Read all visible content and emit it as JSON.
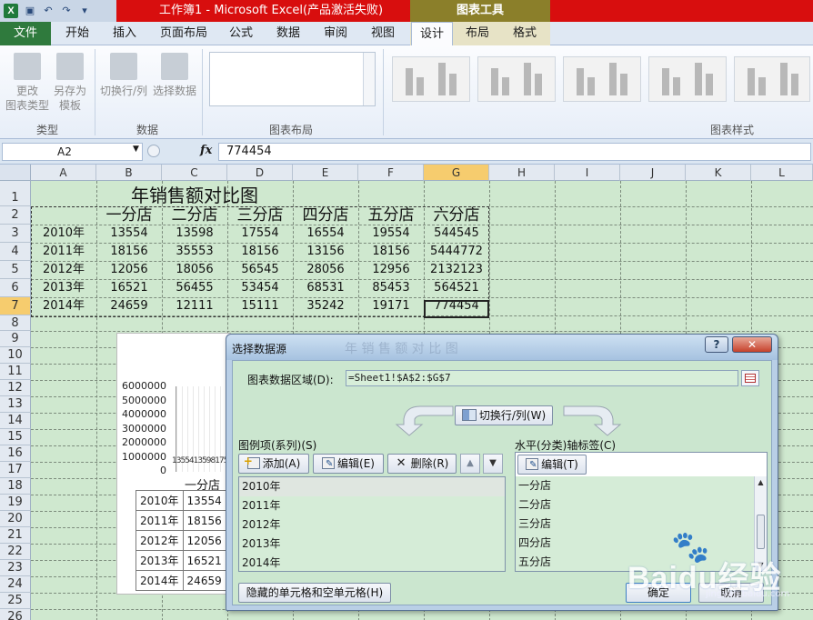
{
  "window": {
    "title": "工作簿1 - Microsoft Excel(产品激活失败)",
    "context_tab_group": "图表工具"
  },
  "ribbon": {
    "tabs": [
      "文件",
      "开始",
      "插入",
      "页面布局",
      "公式",
      "数据",
      "审阅",
      "视图",
      "设计",
      "布局",
      "格式"
    ],
    "active_tab": "设计",
    "groups": {
      "type": {
        "label": "类型",
        "change_type": "更改\n图表类型",
        "save_template": "另存为\n模板"
      },
      "data": {
        "label": "数据",
        "switch_row_col": "切换行/列",
        "select_data": "选择数据"
      },
      "layout": {
        "label": "图表布局"
      },
      "styles": {
        "label": "图表样式"
      }
    }
  },
  "formula_bar": {
    "name_box": "A2",
    "fx": "fx",
    "value": "774454"
  },
  "sheet": {
    "columns": [
      "A",
      "B",
      "C",
      "D",
      "E",
      "F",
      "G",
      "H",
      "I",
      "J",
      "K",
      "L"
    ],
    "selected_column": "G",
    "rows": [
      "1",
      "2",
      "3",
      "4",
      "5",
      "6",
      "7",
      "8",
      "9",
      "10",
      "11",
      "12",
      "13",
      "14",
      "15",
      "16",
      "17",
      "18",
      "19",
      "20",
      "21",
      "22",
      "23",
      "24",
      "25",
      "26"
    ],
    "selected_row": "7",
    "title": "年销售额对比图",
    "headers": [
      "一分店",
      "二分店",
      "三分店",
      "四分店",
      "五分店",
      "六分店"
    ],
    "data": [
      [
        "2010年",
        "13554",
        "13598",
        "17554",
        "16554",
        "19554",
        "544545"
      ],
      [
        "2011年",
        "18156",
        "35553",
        "18156",
        "13156",
        "18156",
        "5444772"
      ],
      [
        "2012年",
        "12056",
        "18056",
        "56545",
        "28056",
        "12956",
        "2132123"
      ],
      [
        "2013年",
        "16521",
        "56455",
        "53454",
        "68531",
        "85453",
        "564521"
      ],
      [
        "2014年",
        "24659",
        "12111",
        "15111",
        "35242",
        "19171",
        "774454"
      ]
    ]
  },
  "chart": {
    "y_ticks": [
      "6000000",
      "5000000",
      "4000000",
      "3000000",
      "2000000",
      "1000000",
      "0"
    ],
    "cluster_labels": "13554135981755416554",
    "category_label": "一分店",
    "data_table": [
      [
        "2010年",
        "13554"
      ],
      [
        "2011年",
        "18156"
      ],
      [
        "2012年",
        "12056"
      ],
      [
        "2013年",
        "16521"
      ],
      [
        "2014年",
        "24659"
      ]
    ]
  },
  "dialog": {
    "title": "选择数据源",
    "ghost_title": "年 销 售 额 对 比 图",
    "help": "?",
    "close": "✕",
    "range_label": "图表数据区域(D):",
    "range_value": "=Sheet1!$A$2:$G$7",
    "switch_button": "切换行/列(W)",
    "legend_label": "图例项(系列)(S)",
    "add": "添加(A)",
    "edit": "编辑(E)",
    "remove": "删除(R)",
    "up": "▲",
    "down": "▼",
    "series": [
      "2010年",
      "2011年",
      "2012年",
      "2013年",
      "2014年"
    ],
    "axis_label": "水平(分类)轴标签(C)",
    "axis_edit": "编辑(T)",
    "categories": [
      "一分店",
      "二分店",
      "三分店",
      "四分店",
      "五分店"
    ],
    "hidden_cells": "隐藏的单元格和空单元格(H)",
    "ok": "确定",
    "cancel": "取消"
  },
  "watermark": {
    "paw": "🐾",
    "text": "Baidu经验",
    "url": "jingyan.baidu.com"
  }
}
